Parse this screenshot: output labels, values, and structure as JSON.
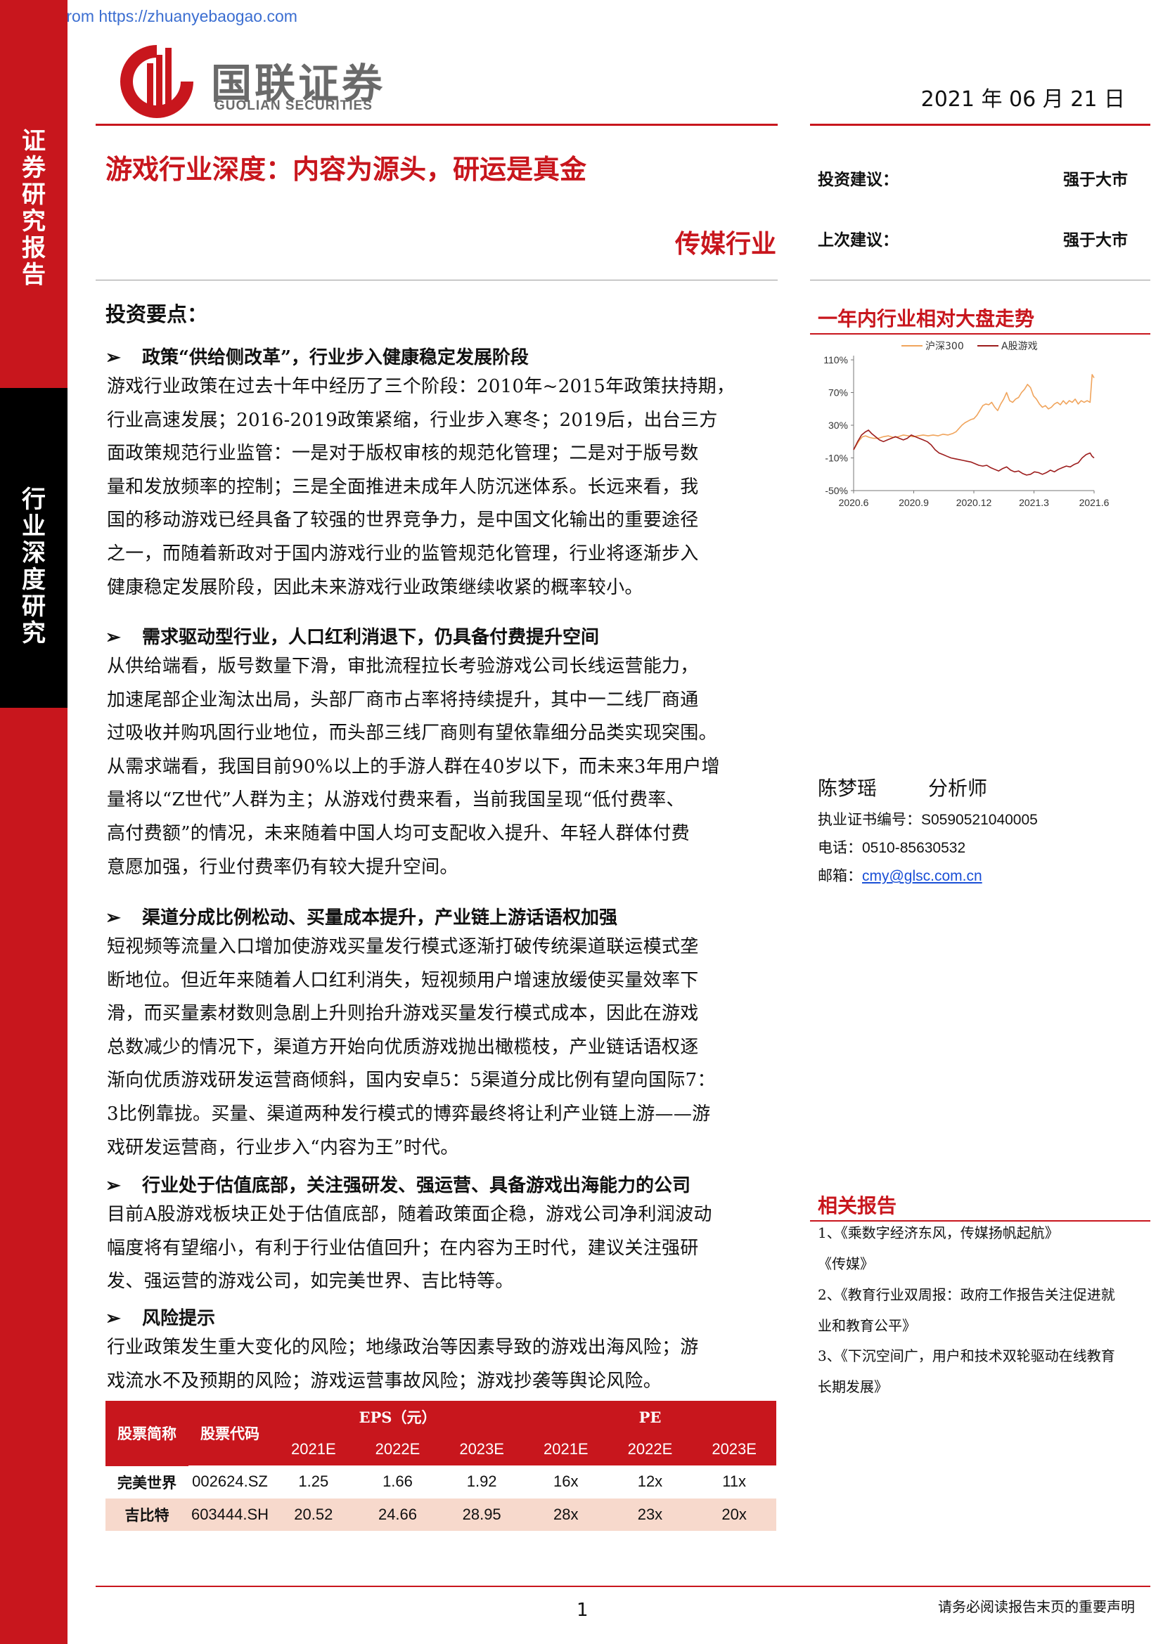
{
  "watermark": "Image From https://zhuanyebaogao.com",
  "sidebar": {
    "top_label": [
      "证",
      "券",
      "研",
      "究",
      "报",
      "告"
    ],
    "mid_label": [
      "行",
      "业",
      "深",
      "度",
      "研",
      "究"
    ]
  },
  "header": {
    "logo_cn": "国联证券",
    "logo_en": "GUOLIAN SECURITIES",
    "date": "2021 年 06 月 21 日"
  },
  "report": {
    "title": "游戏行业深度：内容为源头，研运是真金",
    "industry": "传媒行业"
  },
  "rating": {
    "current_label": "投资建议：",
    "current_value": "强于大市",
    "previous_label": "上次建议：",
    "previous_value": "强于大市"
  },
  "key_points": {
    "heading": "投资要点：",
    "bullet_glyph": "➢",
    "items": [
      {
        "head": "政策“供给侧改革”，行业步入健康稳定发展阶段",
        "lines": [
          "游戏行业政策在过去十年中经历了三个阶段：2010年~2015年政策扶持期，",
          "行业高速发展；2016-2019政策紧缩，行业步入寒冬；2019后，出台三方",
          "面政策规范行业监管：一是对于版权审核的规范化管理；二是对于版号数",
          "量和发放频率的控制；三是全面推进未成年人防沉迷体系。长远来看，我",
          "国的移动游戏已经具备了较强的世界竞争力，是中国文化输出的重要途径",
          "之一，而随着新政对于国内游戏行业的监管规范化管理，行业将逐渐步入",
          "健康稳定发展阶段，因此未来游戏行业政策继续收紧的概率较小。"
        ]
      },
      {
        "head": "需求驱动型行业，人口红利消退下，仍具备付费提升空间",
        "lines": [
          "从供给端看，版号数量下滑，审批流程拉长考验游戏公司长线运营能力，",
          "加速尾部企业淘汰出局，头部厂商市占率将持续提升，其中一二线厂商通",
          "过吸收并购巩固行业地位，而头部三线厂商则有望依靠细分品类实现突围。",
          "从需求端看，我国目前90%以上的手游人群在40岁以下，而未来3年用户增",
          "量将以“Z世代”人群为主；从游戏付费来看，当前我国呈现“低付费率、",
          "高付费额”的情况，未来随着中国人均可支配收入提升、年轻人群体付费",
          "意愿加强，行业付费率仍有较大提升空间。"
        ]
      },
      {
        "head": "渠道分成比例松动、买量成本提升，产业链上游话语权加强",
        "lines": [
          "短视频等流量入口增加使游戏买量发行模式逐渐打破传统渠道联运模式垄",
          "断地位。但近年来随着人口红利消失，短视频用户增速放缓使买量效率下",
          "滑，而买量素材数则急剧上升则抬升游戏买量发行模式成本，因此在游戏",
          "总数减少的情况下，渠道方开始向优质游戏抛出橄榄枝，产业链话语权逐",
          "渐向优质游戏研发运营商倾斜，国内安卓5：5渠道分成比例有望向国际7：",
          "3比例靠拢。买量、渠道两种发行模式的博弈最终将让利产业链上游——游",
          "戏研发运营商，行业步入“内容为王”时代。"
        ]
      },
      {
        "head": "行业处于估值底部，关注强研发、强运营、具备游戏出海能力的公司",
        "lines": [
          "目前A股游戏板块正处于估值底部，随着政策面企稳，游戏公司净利润波动",
          "幅度将有望缩小，有利于行业估值回升；在内容为王时代，建议关注强研",
          "发、强运营的游戏公司，如完美世界、吉比特等。"
        ]
      },
      {
        "head": "风险提示",
        "lines": [
          "行业政策发生重大变化的风险；地缘政治等因素导致的游戏出海风险；游",
          "戏流水不及预期的风险；游戏运营事故风险；游戏抄袭等舆论风险。"
        ]
      }
    ]
  },
  "chart_section": {
    "title": "一年内行业相对大盘走势"
  },
  "chart_data": {
    "type": "line",
    "x": [
      "2020.6",
      "2020.9",
      "2020.12",
      "2021.3",
      "2021.6"
    ],
    "x_ticks": [
      "2020.6",
      "2020.9",
      "2020.12",
      "2021.3",
      "2021.6"
    ],
    "y_ticks": [
      "110%",
      "70%",
      "30%",
      "-10%",
      "-50%"
    ],
    "ylim": [
      -50,
      110
    ],
    "grid": false,
    "legend_position": "top",
    "series": [
      {
        "name": "沪深300",
        "color": "#f0a45c",
        "points": [
          [
            0,
            0
          ],
          [
            3,
            6
          ],
          [
            6,
            12
          ],
          [
            9,
            16
          ],
          [
            12,
            17
          ],
          [
            16,
            15
          ],
          [
            20,
            14
          ],
          [
            25,
            14
          ],
          [
            30,
            16
          ],
          [
            35,
            17
          ],
          [
            40,
            15
          ],
          [
            45,
            16
          ],
          [
            50,
            18
          ],
          [
            55,
            17
          ],
          [
            60,
            16
          ],
          [
            65,
            17
          ],
          [
            70,
            18
          ],
          [
            75,
            17
          ],
          [
            80,
            18
          ],
          [
            85,
            17
          ],
          [
            90,
            19
          ],
          [
            95,
            18
          ],
          [
            100,
            20
          ],
          [
            103,
            22
          ],
          [
            106,
            26
          ],
          [
            109,
            30
          ],
          [
            112,
            33
          ],
          [
            115,
            35
          ],
          [
            118,
            37
          ],
          [
            121,
            38
          ],
          [
            124,
            42
          ],
          [
            127,
            48
          ],
          [
            130,
            54
          ],
          [
            133,
            56
          ],
          [
            136,
            55
          ],
          [
            139,
            58
          ],
          [
            142,
            52
          ],
          [
            145,
            48
          ],
          [
            148,
            56
          ],
          [
            151,
            62
          ],
          [
            154,
            70
          ],
          [
            157,
            60
          ],
          [
            160,
            58
          ],
          [
            163,
            62
          ],
          [
            166,
            64
          ],
          [
            169,
            70
          ],
          [
            172,
            74
          ],
          [
            175,
            80
          ],
          [
            178,
            76
          ],
          [
            181,
            66
          ],
          [
            184,
            62
          ],
          [
            187,
            56
          ],
          [
            190,
            52
          ],
          [
            193,
            54
          ],
          [
            196,
            50
          ],
          [
            199,
            52
          ],
          [
            202,
            56
          ],
          [
            205,
            58
          ],
          [
            208,
            55
          ],
          [
            211,
            60
          ],
          [
            214,
            56
          ],
          [
            217,
            60
          ],
          [
            220,
            58
          ],
          [
            223,
            62
          ],
          [
            226,
            56
          ],
          [
            229,
            60
          ],
          [
            232,
            58
          ],
          [
            235,
            60
          ],
          [
            238,
            58
          ],
          [
            240,
            92
          ],
          [
            242,
            88
          ]
        ]
      },
      {
        "name": "A股游戏",
        "color": "#9c1c1c",
        "points": [
          [
            0,
            0
          ],
          [
            4,
            10
          ],
          [
            8,
            18
          ],
          [
            12,
            22
          ],
          [
            15,
            24
          ],
          [
            18,
            20
          ],
          [
            22,
            16
          ],
          [
            26,
            12
          ],
          [
            30,
            10
          ],
          [
            34,
            12
          ],
          [
            38,
            14
          ],
          [
            42,
            16
          ],
          [
            46,
            14
          ],
          [
            50,
            12
          ],
          [
            54,
            14
          ],
          [
            58,
            18
          ],
          [
            62,
            16
          ],
          [
            66,
            14
          ],
          [
            70,
            12
          ],
          [
            74,
            10
          ],
          [
            78,
            6
          ],
          [
            82,
            0
          ],
          [
            86,
            -4
          ],
          [
            90,
            -6
          ],
          [
            94,
            -8
          ],
          [
            98,
            -10
          ],
          [
            102,
            -11
          ],
          [
            106,
            -12
          ],
          [
            110,
            -13
          ],
          [
            114,
            -14
          ],
          [
            118,
            -15
          ],
          [
            122,
            -17
          ],
          [
            126,
            -19
          ],
          [
            130,
            -20
          ],
          [
            134,
            -19
          ],
          [
            138,
            -22
          ],
          [
            142,
            -24
          ],
          [
            146,
            -26
          ],
          [
            150,
            -23
          ],
          [
            154,
            -21
          ],
          [
            158,
            -25
          ],
          [
            162,
            -27
          ],
          [
            166,
            -26
          ],
          [
            170,
            -29
          ],
          [
            174,
            -31
          ],
          [
            178,
            -30
          ],
          [
            182,
            -27
          ],
          [
            186,
            -28
          ],
          [
            190,
            -30
          ],
          [
            194,
            -28
          ],
          [
            198,
            -25
          ],
          [
            202,
            -27
          ],
          [
            206,
            -24
          ],
          [
            210,
            -22
          ],
          [
            214,
            -20
          ],
          [
            218,
            -21
          ],
          [
            222,
            -18
          ],
          [
            226,
            -16
          ],
          [
            230,
            -10
          ],
          [
            234,
            -6
          ],
          [
            238,
            -4
          ],
          [
            240,
            -8
          ],
          [
            242,
            -10
          ]
        ]
      }
    ]
  },
  "analyst": {
    "name": "陈梦瑶",
    "role": "分析师",
    "cert_label": "执业证书编号：",
    "cert_value": "S0590521040005",
    "phone_label": "电话：",
    "phone_value": "0510-85630532",
    "email_label": "邮箱：",
    "email_value": "cmy@glsc.com.cn"
  },
  "related_reports": {
    "title": "相关报告",
    "items": [
      [
        "1、《乘数字经济东风，传媒扬帆起航》",
        "《传媒》"
      ],
      [
        "2、《教育行业双周报：政府工作报告关注促进就",
        "业和教育公平》"
      ],
      [
        "3、《下沉空间广，用户和技术双轮驱动在线教育",
        "长期发展》"
      ]
    ]
  },
  "table": {
    "col_name": "股票简称",
    "col_code": "股票代码",
    "group_eps": "EPS（元）",
    "group_pe": "PE",
    "years": [
      "2021E",
      "2022E",
      "2023E",
      "2021E",
      "2022E",
      "2023E"
    ],
    "rows": [
      {
        "name": "完美世界",
        "code": "002624.SZ",
        "values": [
          "1.25",
          "1.66",
          "1.92",
          "16x",
          "12x",
          "11x"
        ]
      },
      {
        "name": "吉比特",
        "code": "603444.SH",
        "values": [
          "20.52",
          "24.66",
          "28.95",
          "28x",
          "23x",
          "20x"
        ]
      }
    ]
  },
  "footer": {
    "page": "1",
    "note": "请务必阅读报告末页的重要声明"
  }
}
